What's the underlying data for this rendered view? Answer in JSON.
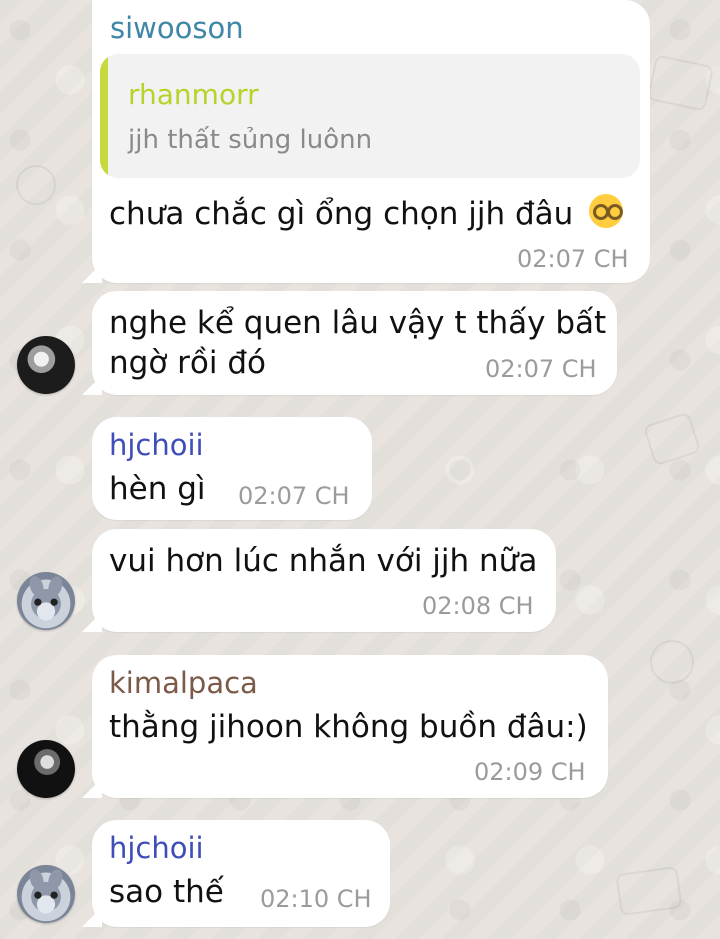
{
  "chat": {
    "messages": [
      {
        "sender": "siwooson",
        "sender_color": "#3f87a6",
        "reply": {
          "sender": "rhanmorr",
          "text": "jjh thất sủng luônn"
        },
        "text": "chưa chắc gì ổng chọn jjh đâu",
        "emoji_label": "🤓",
        "time": "02:07 CH"
      },
      {
        "line1": "nghe kể quen lâu vậy t thấy bất",
        "line2": "ngờ rồi đó",
        "time": "02:07 CH"
      },
      {
        "sender": "hjchoii",
        "sender_color": "#3f4db8",
        "text": "hèn gì",
        "time": "02:07 CH"
      },
      {
        "text": "vui hơn lúc nhắn với jjh nữa",
        "time": "02:08 CH"
      },
      {
        "sender": "kimalpaca",
        "sender_color": "#7b5a47",
        "text": "thằng jihoon không buồn đâu:)",
        "time": "02:09 CH"
      },
      {
        "sender": "hjchoii",
        "sender_color": "#3f4db8",
        "text": "sao thế",
        "time": "02:10 CH"
      }
    ]
  }
}
